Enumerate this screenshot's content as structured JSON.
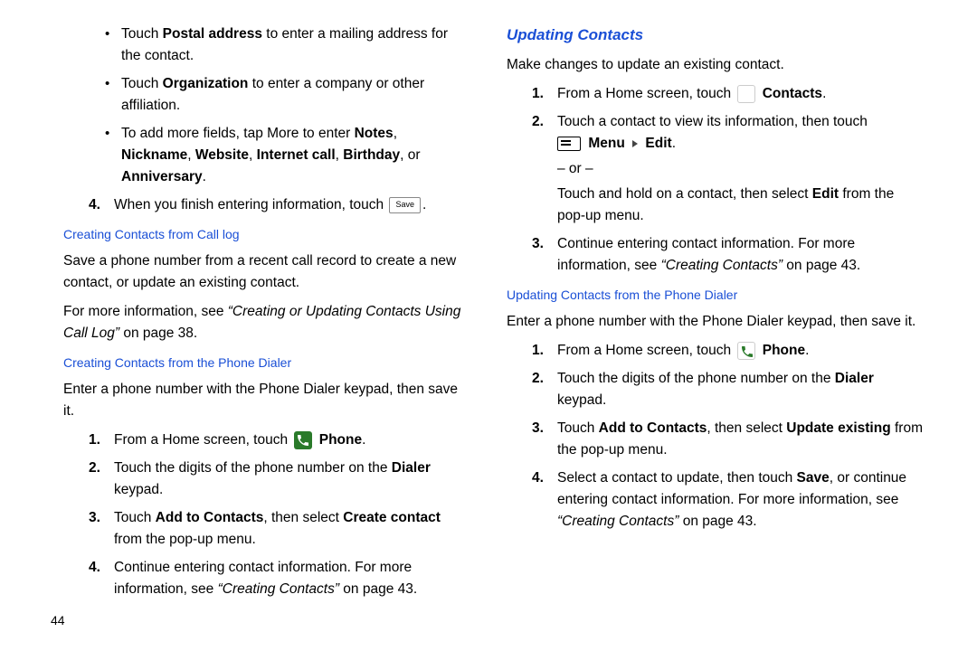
{
  "left": {
    "bullets": {
      "postal_prefix": "Touch ",
      "postal_bold": "Postal address",
      "postal_suffix": " to enter a mailing address for the contact.",
      "org_prefix": "Touch ",
      "org_bold": "Organization",
      "org_suffix": " to enter a company or other affiliation.",
      "more_prefix": "To add more fields, tap More to enter ",
      "more_b1": "Notes",
      "more_sep1": ", ",
      "more_b2": "Nickname",
      "more_sep2": ", ",
      "more_b3": "Website",
      "more_sep3": ", ",
      "more_b4": "Internet call",
      "more_sep4": ", ",
      "more_b5": "Birthday",
      "more_sep5": ", or ",
      "more_b6": "Anniversary",
      "more_end": "."
    },
    "step4_num": "4.",
    "step4_text": "When you finish entering information, touch",
    "step4_save": "Save",
    "step4_end": ".",
    "sub1": "Creating Contacts from Call log",
    "sub1_p1": "Save a phone number from a recent call record to create a new contact, or update an existing contact.",
    "sub1_p2a": "For more information, see ",
    "sub1_p2q": "“Creating or Updating Contacts Using Call Log”",
    "sub1_p2b": " on page 38.",
    "sub2": "Creating Contacts from the Phone Dialer",
    "sub2_p1": "Enter a phone number with the Phone Dialer keypad, then save it.",
    "dialer_steps": {
      "n1": "1.",
      "s1a": "From a Home screen, touch ",
      "s1_phone": "Phone",
      "s1b": ".",
      "n2": "2.",
      "s2a": "Touch the digits of the phone number on the ",
      "s2_dialer": "Dialer",
      "s2b": " keypad.",
      "n3": "3.",
      "s3a": "Touch ",
      "s3_b1": "Add to Contacts",
      "s3b": ", then select ",
      "s3_b2": "Create contact",
      "s3c": " from the pop-up menu.",
      "n4": "4.",
      "s4a": "Continue entering contact information. For more information, see ",
      "s4q": "“Creating Contacts”",
      "s4b": " on page 43."
    }
  },
  "right": {
    "heading": "Updating Contacts",
    "intro": "Make changes to update an existing contact.",
    "steps": {
      "n1": "1.",
      "s1a": "From a Home screen, touch ",
      "s1_contacts": "Contacts",
      "s1b": ".",
      "n2": "2.",
      "s2a": "Touch a contact to view its information, then touch",
      "s2_menu": "Menu",
      "s2_edit": "Edit",
      "s2b": ".",
      "s2_or": "– or –",
      "s2c_a": "Touch and hold on a contact, then select ",
      "s2c_edit": "Edit",
      "s2c_b": " from the pop-up menu.",
      "n3": "3.",
      "s3a": "Continue entering contact information. For more information, see ",
      "s3q": "“Creating Contacts”",
      "s3b": " on page 43."
    },
    "sub": "Updating Contacts from the Phone Dialer",
    "sub_p1": "Enter a phone number with the Phone Dialer keypad, then save it.",
    "dialer_steps": {
      "n1": "1.",
      "s1a": "From a Home screen, touch ",
      "s1_phone": "Phone",
      "s1b": ".",
      "n2": "2.",
      "s2a": "Touch the digits of the phone number on the ",
      "s2_dialer": "Dialer",
      "s2b": " keypad.",
      "n3": "3.",
      "s3a": "Touch ",
      "s3_b1": "Add to Contacts",
      "s3b": ", then select ",
      "s3_b2": "Update  existing",
      "s3c": " from the pop-up menu.",
      "n4": "4.",
      "s4a": "Select a contact to update, then touch ",
      "s4_save": "Save",
      "s4b": ", or continue entering contact information. For more information, see ",
      "s4q": "“Creating Contacts”",
      "s4c": " on page 43."
    }
  },
  "page_number": "44"
}
